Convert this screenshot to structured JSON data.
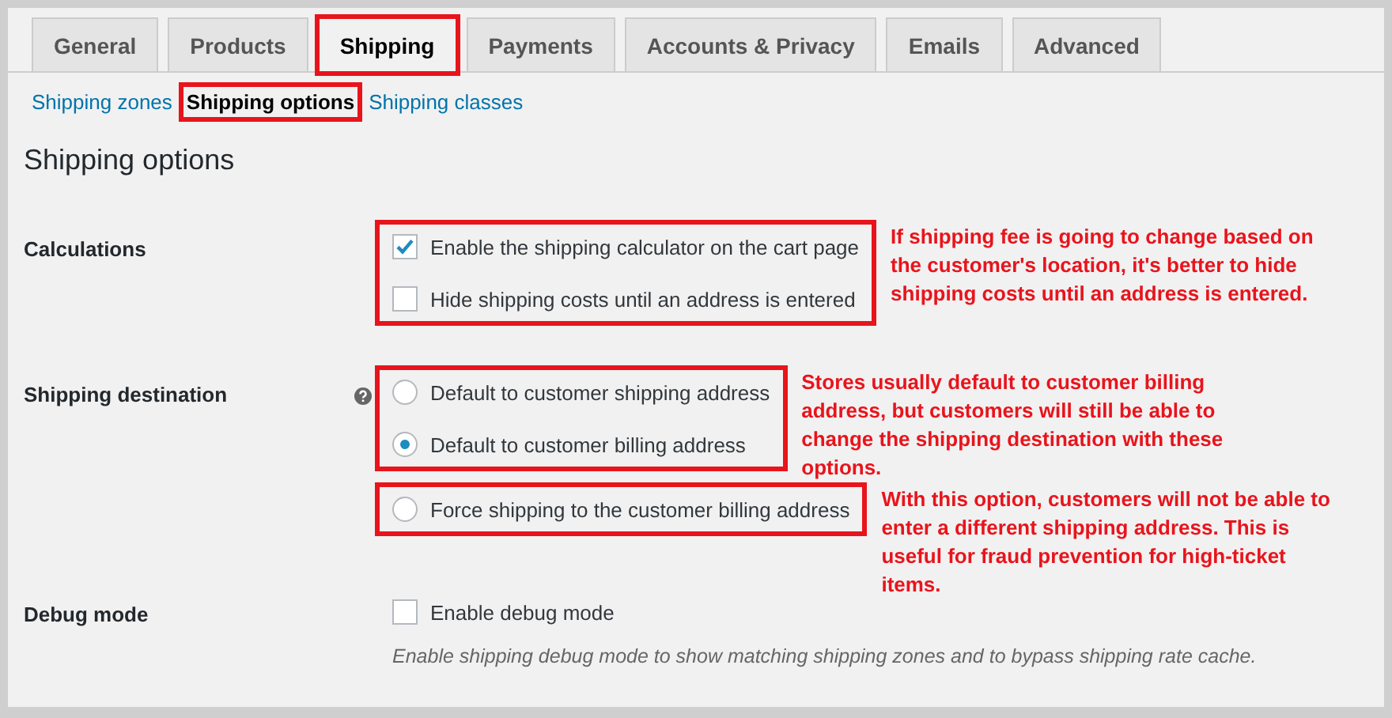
{
  "tabs": [
    {
      "label": "General",
      "selected": false,
      "highlighted": false
    },
    {
      "label": "Products",
      "selected": false,
      "highlighted": false
    },
    {
      "label": "Shipping",
      "selected": true,
      "highlighted": true
    },
    {
      "label": "Payments",
      "selected": false,
      "highlighted": false
    },
    {
      "label": "Accounts & Privacy",
      "selected": false,
      "highlighted": false
    },
    {
      "label": "Emails",
      "selected": false,
      "highlighted": false
    },
    {
      "label": "Advanced",
      "selected": false,
      "highlighted": false
    }
  ],
  "subnav": [
    {
      "label": "Shipping zones",
      "selected": false,
      "highlighted": false
    },
    {
      "label": "Shipping options",
      "selected": true,
      "highlighted": true
    },
    {
      "label": "Shipping classes",
      "selected": false,
      "highlighted": false
    }
  ],
  "section_title": "Shipping options",
  "settings": [
    {
      "label": "Calculations",
      "help_icon": false,
      "groups": [
        {
          "highlighted": true,
          "note": "If shipping fee is going to change based on the customer's location, it's better to hide shipping costs until an address is entered.",
          "options": [
            {
              "kind": "checkbox",
              "label": "Enable the shipping calculator on the cart page",
              "checked": true
            },
            {
              "kind": "checkbox",
              "label": "Hide shipping costs until an address is entered",
              "checked": false
            }
          ]
        }
      ]
    },
    {
      "label": "Shipping destination",
      "help_icon": true,
      "groups": [
        {
          "highlighted": true,
          "note": "Stores usually default to customer billing address, but customers will still be able to change the shipping destination with these options.",
          "options": [
            {
              "kind": "radio",
              "label": "Default to customer shipping address",
              "selected": false
            },
            {
              "kind": "radio",
              "label": "Default to customer billing address",
              "selected": true
            }
          ]
        },
        {
          "highlighted": true,
          "note": "With this option, customers will not be able to enter a different shipping address. This is useful for fraud prevention for high-ticket items.",
          "options": [
            {
              "kind": "radio",
              "label": "Force shipping to the customer billing address",
              "selected": false
            }
          ]
        }
      ]
    },
    {
      "label": "Debug mode",
      "help_icon": false,
      "groups": [
        {
          "highlighted": false,
          "options": [
            {
              "kind": "checkbox",
              "label": "Enable debug mode",
              "checked": false
            }
          ]
        }
      ],
      "description": "Enable shipping debug mode to show matching shipping zones and to bypass shipping rate cache."
    }
  ]
}
